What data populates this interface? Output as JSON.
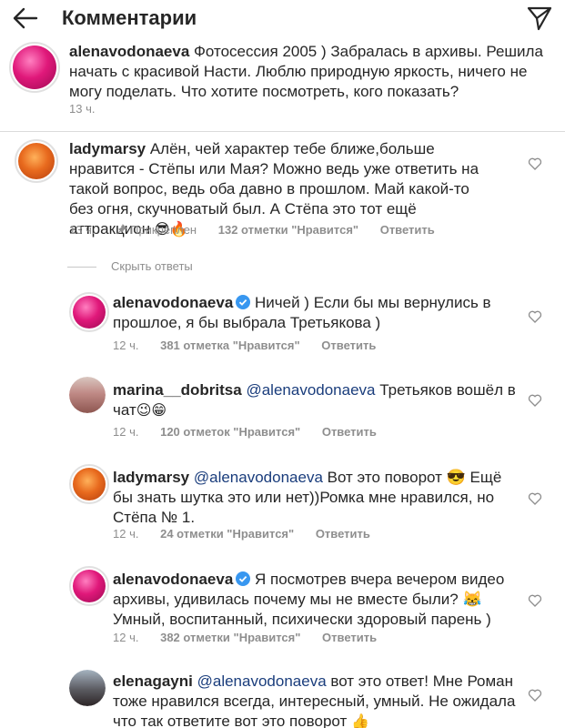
{
  "header": {
    "title": "Комментарии"
  },
  "caption": {
    "username": "alenavodonaeva",
    "text": " Фотосессия 2005 ) Забралась в архивы. Решила начать с красивой Насти. Люблю природную яркость, ничего не могу поделать. Что хотите посмотреть, кого показать?",
    "time": "13 ч."
  },
  "comments": [
    {
      "username": "ladymarsy",
      "text": " Алён, чей характер тебе ближе,больше нравится - Стёпы или Мая? Можно ведь уже ответить на такой вопрос, ведь оба давно в прошлом. Май какой-то без огня, скучноватый был. А Стёпа это тот ещё аттракцион",
      "emoji": "😎🔥",
      "time": "13 ч.",
      "pinned": "Прикреплен",
      "likes": "132 отметки \"Нравится\"",
      "reply": "Ответить"
    }
  ],
  "hide_replies": "Скрыть ответы",
  "replies": [
    {
      "username": "alenavodonaeva",
      "verified": true,
      "mention": "",
      "text": " Ничей ) Если бы мы вернулись в прошлое, я бы выбрала Третьякова )",
      "emoji": "",
      "time": "12 ч.",
      "likes": "381 отметка \"Нравится\"",
      "reply": "Ответить"
    },
    {
      "username": "marina__dobritsa",
      "verified": false,
      "mention": "@alenavodonaeva",
      "text": " Третьяков  вошёл в чат",
      "emoji": "😉😁",
      "time": "12 ч.",
      "likes": "120 отметок \"Нравится\"",
      "reply": "Ответить"
    },
    {
      "username": "ladymarsy",
      "verified": false,
      "mention": "@alenavodonaeva",
      "text": " Вот это поворот 😎 Ещё бы знать шутка это или нет))Ромка мне нравился, но Стёпа № 1.",
      "emoji": "",
      "time": "12 ч.",
      "likes": "24 отметки \"Нравится\"",
      "reply": "Ответить"
    },
    {
      "username": "alenavodonaeva",
      "verified": true,
      "mention": "",
      "text": " Я посмотрев вчера вечером видео архивы, удивилась почему мы не вместе были? 😹 Умный, воспитанный, психически здоровый парень )",
      "emoji": "",
      "time": "12 ч.",
      "likes": "382 отметки \"Нравится\"",
      "reply": "Ответить"
    },
    {
      "username": "elenagayni",
      "verified": false,
      "mention": "@alenavodonaeva",
      "text": " вот это ответ! Мне Роман тоже нравился всегда, интересный, умный. Не ожидала что так ответите вот это поворот",
      "emoji": "👍",
      "time": "",
      "likes": "",
      "reply": ""
    }
  ],
  "colors": {
    "text": "#262626",
    "secondary": "#8e8e8e",
    "mention": "#1a3d7c",
    "verified": "#3897f0"
  }
}
